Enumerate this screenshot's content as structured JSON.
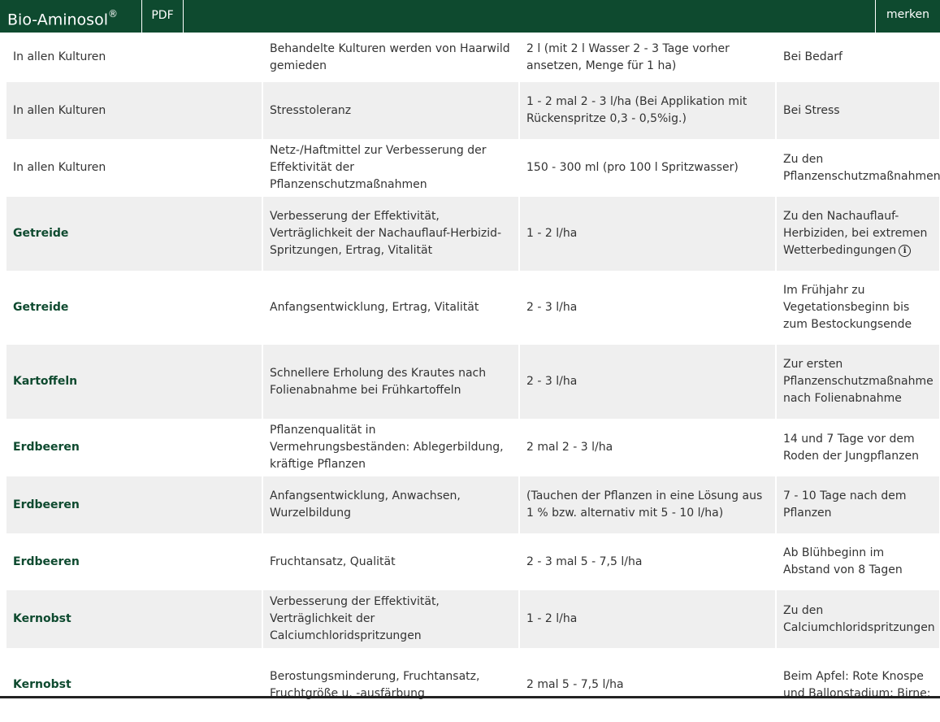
{
  "header": {
    "title": "Bio-Aminosol",
    "title_mark": "®",
    "pdf_label": "PDF",
    "merken_label": "merken"
  },
  "rows": [
    {
      "crop": "In allen Kulturen",
      "crop_bold": false,
      "purpose": "Behandelte Kulturen werden von Haarwild gemieden",
      "dose": "2 l (mit 2 l Wasser 2 - 3 Tage vorher ansetzen, Menge für 1 ha)",
      "timing": "Bei Bedarf",
      "shaded": false,
      "height": 61
    },
    {
      "crop": "In allen Kulturen",
      "crop_bold": false,
      "purpose": "Stresstoleranz",
      "dose": "1 - 2 mal 2 - 3 l/ha (Bei Applikation mit Rückenspritze 0,3 - 0,5%ig.)",
      "timing": "Bei Stress",
      "shaded": true,
      "height": 70
    },
    {
      "crop": "In allen Kulturen",
      "crop_bold": false,
      "purpose": "Netz-/Haftmittel zur Verbesserung der Effektivität der Pflanzenschutzmaßnahmen",
      "dose": "150 - 300 ml (pro 100 l Spritzwasser)",
      "timing": "Zu den Pflanzenschutzmaßnahmen",
      "shaded": false,
      "height": 70
    },
    {
      "crop": "Getreide",
      "crop_bold": true,
      "purpose": "Verbesserung der Effektivität, Verträglichkeit der Nachauflauf-Herbizid-Spritzungen, Ertrag, Vitalität",
      "dose": "1 - 2 l/ha",
      "timing": "Zu den Nachauflauf-Herbiziden, bei extremen Wetterbedingungen",
      "info_icon": "i",
      "shaded": true,
      "height": 91
    },
    {
      "crop": "Getreide",
      "crop_bold": true,
      "purpose": "Anfangsentwicklung, Ertrag, Vitalität",
      "dose": "2 - 3 l/ha",
      "timing": "Im Frühjahr zu Vegetationsbeginn bis zum Bestockungsende",
      "shaded": false,
      "height": 91
    },
    {
      "crop": "Kartoffeln",
      "crop_bold": true,
      "purpose": "Schnellere Erholung des Krautes nach Folienabnahme bei Frühkartoffeln",
      "dose": "2 - 3 l/ha",
      "timing": "Zur ersten Pflanzenschutzmaßnahme nach Folienabnahme",
      "shaded": true,
      "height": 91
    },
    {
      "crop": "Erdbeeren",
      "crop_bold": true,
      "purpose": "Pflanzenqualität in Vermehrungsbeständen: Ablegerbildung, kräftige Pflanzen",
      "dose": "2 mal 2 - 3 l/ha",
      "timing": "14 und 7 Tage vor dem Roden der Jungpflanzen",
      "shaded": false,
      "height": 70
    },
    {
      "crop": "Erdbeeren",
      "crop_bold": true,
      "purpose": "Anfangsentwicklung, Anwachsen, Wurzelbildung",
      "dose": "(Tauchen der Pflanzen in eine Lösung aus 1 % bzw. alternativ mit 5 - 10 l/ha)",
      "timing": "7 - 10 Tage nach dem Pflanzen",
      "shaded": true,
      "height": 70
    },
    {
      "crop": "Erdbeeren",
      "crop_bold": true,
      "purpose": "Fruchtansatz, Qualität",
      "dose": "2 - 3 mal 5 - 7,5 l/ha",
      "timing": "Ab Blühbeginn im Abstand von 8 Tagen",
      "shaded": false,
      "height": 70
    },
    {
      "crop": "Kernobst",
      "crop_bold": true,
      "purpose": "Verbesserung der Effektivität, Verträglichkeit der Calciumchloridspritzungen",
      "dose": "1 - 2 l/ha",
      "timing": "Zu den Calciumchloridspritzungen",
      "shaded": true,
      "height": 70
    },
    {
      "crop": "Kernobst",
      "crop_bold": true,
      "purpose": "Berostungsminderung, Fruchtansatz, Fruchtgröße u. -ausfärbung",
      "dose": "2 mal 5 - 7,5 l/ha",
      "timing": "Beim Apfel: Rote Knospe und Ballonstadium; Birne:",
      "shaded": false,
      "height": 91
    }
  ],
  "colors": {
    "header_bg": "#0e4a2f",
    "crop_text": "#0e4a2f",
    "row_shade": "#efefef"
  }
}
